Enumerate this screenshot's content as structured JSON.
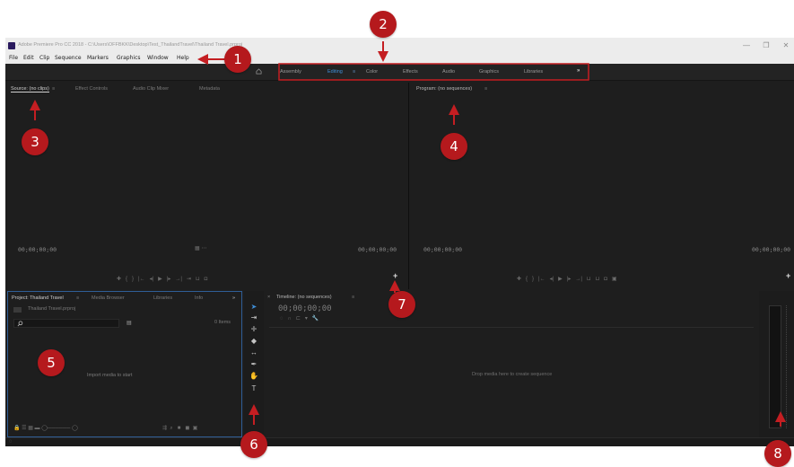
{
  "window": {
    "title": "Adobe Premiere Pro CC 2018 - C:\\Users\\OFFBKK\\Desktop\\Test_ThailandTravel\\Thailand Travel.prproj",
    "minimize": "—",
    "restore": "❐",
    "close": "✕"
  },
  "menu": [
    "File",
    "Edit",
    "Clip",
    "Sequence",
    "Markers",
    "Graphics",
    "Window",
    "Help"
  ],
  "workspaces": {
    "tabs": [
      "Assembly",
      "Editing",
      "Color",
      "Effects",
      "Audio",
      "Graphics",
      "Libraries"
    ],
    "active": "Editing",
    "more": "»"
  },
  "source_panel": {
    "tabs": [
      "Source: (no clips)",
      "Effect Controls",
      "Audio Clip Mixer",
      "Metadata"
    ],
    "timecode_left": "00;00;00;00",
    "timecode_right": "00;00;00;00"
  },
  "program_panel": {
    "tabs": [
      "Program: (no sequences)"
    ],
    "timecode_left": "00;00;00;00",
    "timecode_right": "00;00;00;00"
  },
  "project_panel": {
    "tabs": [
      "Project: Thailand Travel",
      "Media Browser",
      "Libraries",
      "Info"
    ],
    "file": "Thailand Travel.prproj",
    "item_count": "0 Items",
    "empty_message": "Import media to start"
  },
  "timeline_panel": {
    "tab": "Timeline: (no sequences)",
    "timecode": "00;00;00;00",
    "empty_message": "Drop media here to create sequence"
  },
  "callouts": [
    "1",
    "2",
    "3",
    "4",
    "5",
    "6",
    "7",
    "8"
  ],
  "colors": {
    "callout": "#b5191d",
    "accent": "#3f8fd8",
    "panel_bg": "#1e1e1e"
  }
}
